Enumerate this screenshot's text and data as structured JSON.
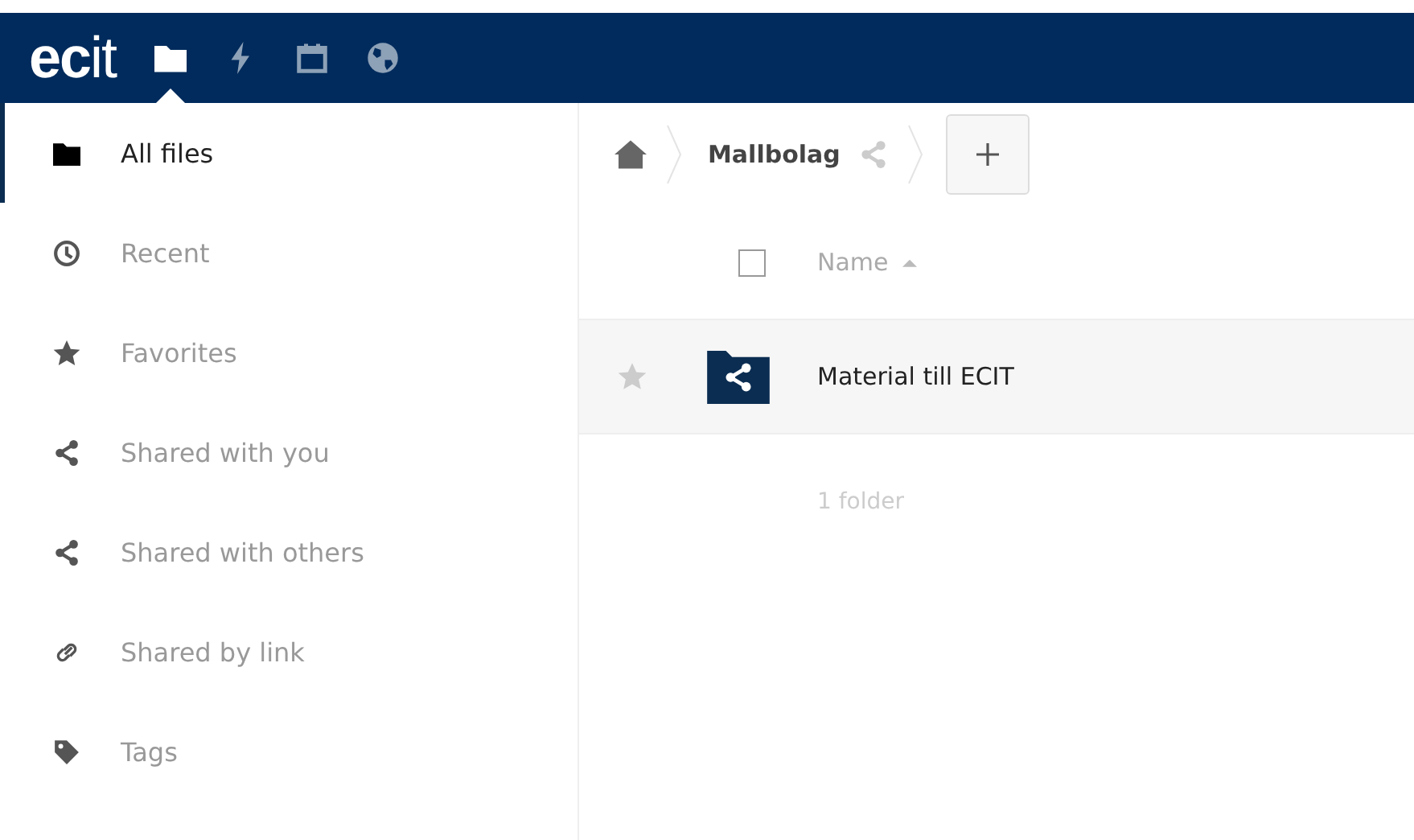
{
  "header": {
    "logo": "**ec**it",
    "apps": [
      {
        "kind": "folder",
        "selected": true
      },
      {
        "kind": "activity",
        "selected": false
      },
      {
        "kind": "calendar",
        "selected": false
      },
      {
        "kind": "globe",
        "selected": false
      }
    ]
  },
  "sidebar": {
    "items": [
      {
        "label": "All files",
        "kind": "folder",
        "selected": true
      },
      {
        "label": "Recent",
        "kind": "clock",
        "selected": false
      },
      {
        "label": "Favorites",
        "kind": "star",
        "selected": false
      },
      {
        "label": "Shared with you",
        "kind": "share",
        "selected": false
      },
      {
        "label": "Shared with others",
        "kind": "share",
        "selected": false
      },
      {
        "label": "Shared by link",
        "kind": "link",
        "selected": false
      },
      {
        "label": "Tags",
        "kind": "tag",
        "selected": false
      }
    ]
  },
  "breadcrumb": {
    "folder": "Mallbolag",
    "shared": true
  },
  "table": {
    "columns": [
      {
        "label": "Name",
        "sorted_ascending": true
      }
    ],
    "select_all_checked": false,
    "rows": [
      {
        "name": "Material till ECIT",
        "kind": "shared-folder",
        "starred": false
      }
    ],
    "summary": "1 folder"
  }
}
